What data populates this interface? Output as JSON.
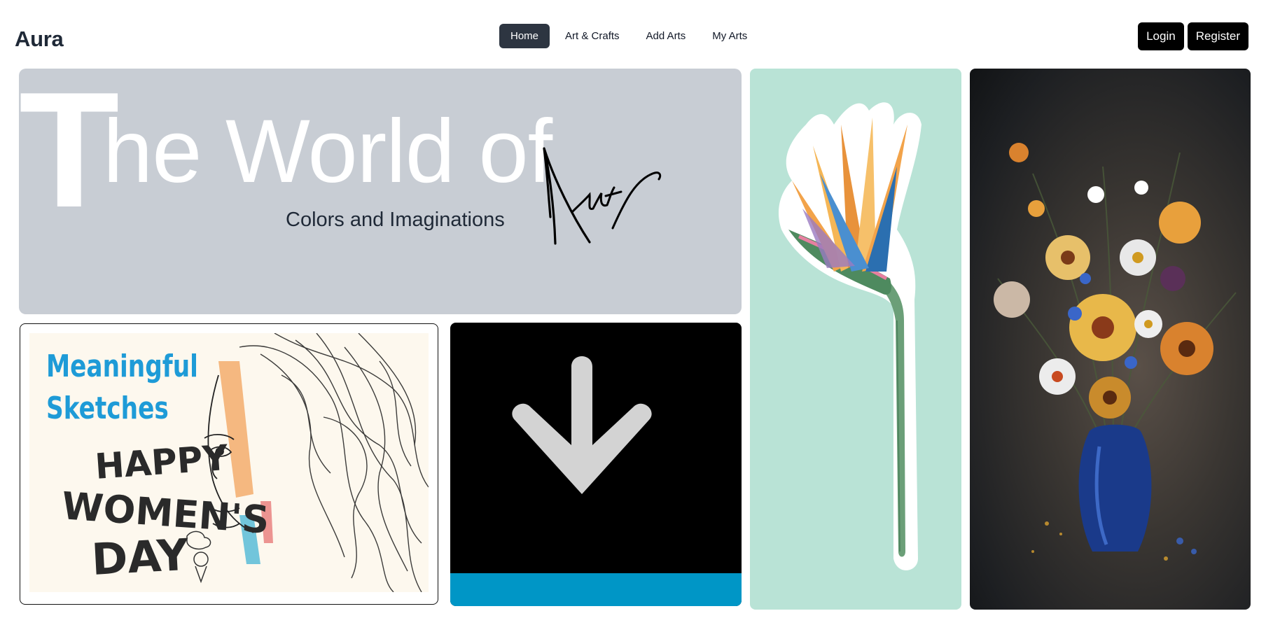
{
  "navbar": {
    "brand": "Aura",
    "links": [
      {
        "label": "Home",
        "active": true
      },
      {
        "label": "Art & Crafts",
        "active": false
      },
      {
        "label": "Add Arts",
        "active": false
      },
      {
        "label": "My Arts",
        "active": false
      }
    ],
    "login_label": "Login",
    "register_label": "Register"
  },
  "hero": {
    "title_initial": "T",
    "title_rest": "he World of",
    "subtitle": "Colors and Imaginations",
    "signature_text": "Aura",
    "background": "#c8cdd4"
  },
  "gallery": {
    "sketch_card": {
      "title_line1": "Meaningful",
      "title_line2": "Sketches",
      "lettering": "HAPPY WOMEN'S DAY",
      "title_color": "#1e9bd7"
    },
    "arrow_card": {
      "icon": "arrow-down-icon",
      "strip_color": "#0096c6"
    },
    "flower_card": {
      "subject": "bird-of-paradise-flower",
      "background": "#b9e3d6"
    },
    "bouquet_card": {
      "subject": "flower-bouquet-painting"
    }
  },
  "colors": {
    "nav_active": "#2d3541",
    "button": "#000000"
  }
}
